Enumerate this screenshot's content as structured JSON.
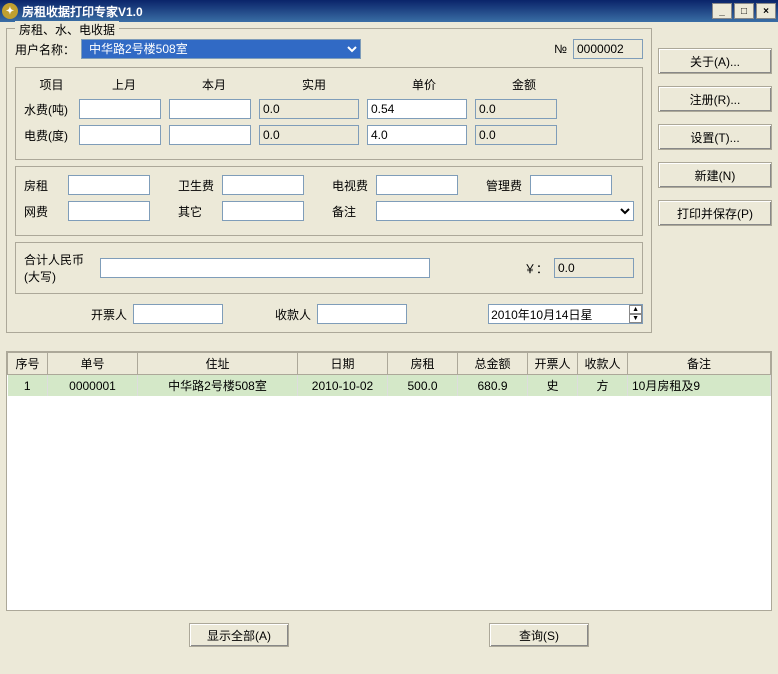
{
  "window": {
    "title": "房租收据打印专家V1.0",
    "minimize": "_",
    "maximize": "□",
    "close": "×"
  },
  "groupbox_title": "房租、水、电收据",
  "labels": {
    "username": "用户名称：",
    "number": "№",
    "headers": {
      "item": "项目",
      "last": "上月",
      "this": "本月",
      "actual": "实用",
      "price": "单价",
      "amount": "金额"
    },
    "water": "水费(吨)",
    "elec": "电费(度)",
    "rent": "房租",
    "sanitation": "卫生费",
    "tv": "电视费",
    "mgmt": "管理费",
    "net": "网费",
    "other": "其它",
    "remark": "备注",
    "total": "合计人民币\n(大写)",
    "yen": "￥：",
    "biller": "开票人",
    "payee": "收款人"
  },
  "fields": {
    "username": "中华路2号楼508室",
    "number": "0000002",
    "water": {
      "last": "",
      "this": "",
      "actual": "0.0",
      "price": "0.54",
      "amount": "0.0"
    },
    "elec": {
      "last": "",
      "this": "",
      "actual": "0.0",
      "price": "4.0",
      "amount": "0.0"
    },
    "rent": "",
    "sanitation": "",
    "tv": "",
    "mgmt": "",
    "net": "",
    "other": "",
    "remark": "",
    "total_words": "",
    "total_num": "0.0",
    "biller": "",
    "payee": "",
    "date": "2010年10月14日星"
  },
  "buttons": {
    "about": "关于(A)...",
    "register": "注册(R)...",
    "settings": "设置(T)...",
    "new": "新建(N)",
    "printsave": "打印并保存(P)",
    "showall": "显示全部(A)",
    "query": "查询(S)"
  },
  "table": {
    "headers": [
      "序号",
      "单号",
      "住址",
      "日期",
      "房租",
      "总金额",
      "开票人",
      "收款人",
      "备注"
    ],
    "rows": [
      {
        "seq": "1",
        "no": "0000001",
        "addr": "中华路2号楼508室",
        "date": "2010-10-02",
        "rent": "500.0",
        "total": "680.9",
        "biller": "史",
        "payee": "方",
        "remark": "10月房租及9"
      }
    ]
  }
}
